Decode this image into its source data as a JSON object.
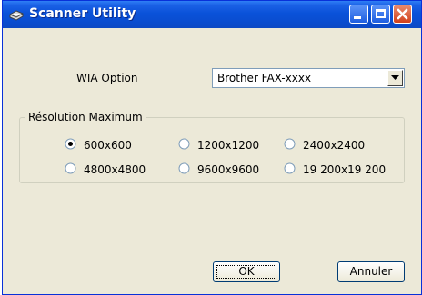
{
  "window": {
    "title": "Scanner Utility"
  },
  "wia": {
    "label": "WIA Option",
    "selected": "Brother FAX-xxxx"
  },
  "resolution": {
    "legend": "Résolution Maximum",
    "options": [
      {
        "label": "600x600",
        "checked": true
      },
      {
        "label": "1200x1200",
        "checked": false
      },
      {
        "label": "2400x2400",
        "checked": false
      },
      {
        "label": "4800x4800",
        "checked": false
      },
      {
        "label": "9600x9600",
        "checked": false
      },
      {
        "label": "19 200x19 200",
        "checked": false
      }
    ]
  },
  "buttons": {
    "ok": "OK",
    "cancel": "Annuler"
  }
}
